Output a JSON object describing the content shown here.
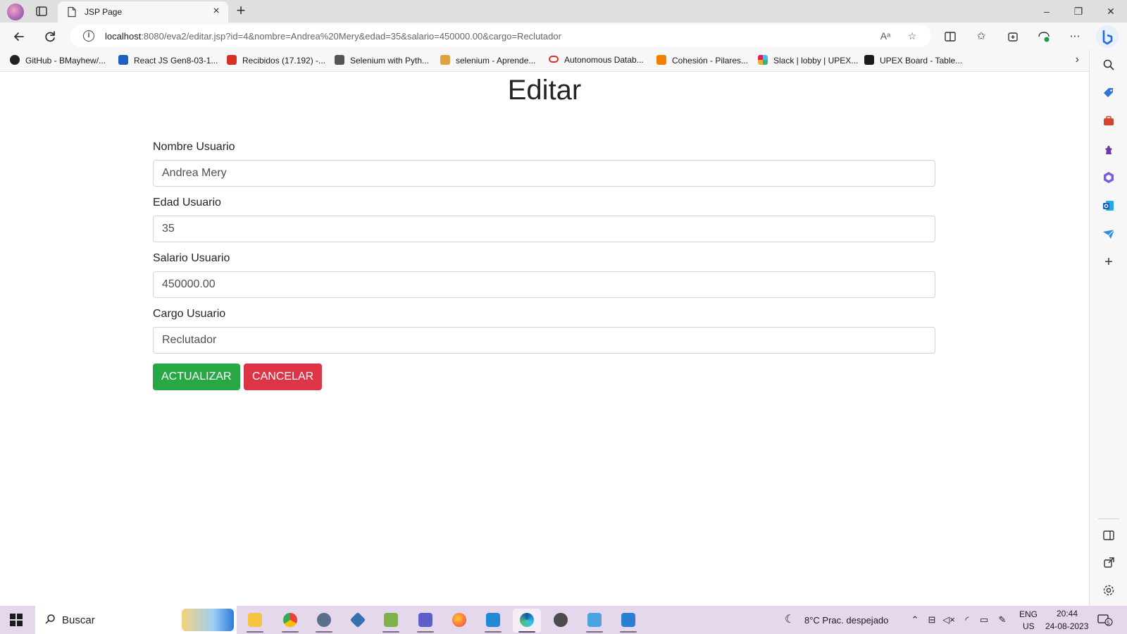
{
  "browser": {
    "tab_title": "JSP Page",
    "new_tab_symbol": "+",
    "close_symbol": "×",
    "window_controls": {
      "minimize": "–",
      "maximize": "❐",
      "close": "✕"
    },
    "url_host": "localhost",
    "url_rest": ":8080/eva2/editar.jsp?id=4&nombre=Andrea%20Mery&edad=35&salario=450000.00&cargo=Reclutador",
    "more_symbol": "⋯"
  },
  "bookmarks": [
    {
      "label": "GitHub - BMayhew/...",
      "icon": "github-icon",
      "color": "#222222"
    },
    {
      "label": "React JS Gen8-03-1...",
      "icon": "person-badge-icon",
      "color": "#1f5fbf"
    },
    {
      "label": "Recibidos (17.192) -...",
      "icon": "gmail-icon",
      "color": "#d93025"
    },
    {
      "label": "Selenium with Pyth...",
      "icon": "doc-icon",
      "color": "#555555"
    },
    {
      "label": "selenium - Aprende...",
      "icon": "selenium-icon",
      "color": "#e2a23b"
    },
    {
      "label": "Autonomous Datab...",
      "icon": "oracle-icon",
      "color": "#e0301e"
    },
    {
      "label": "Cohesión - Pilares...",
      "icon": "blogger-icon",
      "color": "#f57d00"
    },
    {
      "label": "Slack | lobby | UPEX...",
      "icon": "slack-icon",
      "color": "#e01e5a"
    },
    {
      "label": "UPEX Board - Table...",
      "icon": "upex-icon",
      "color": "#1b1b1b"
    }
  ],
  "page": {
    "title": "Editar",
    "fields": [
      {
        "label": "Nombre Usuario",
        "value": "Andrea Mery"
      },
      {
        "label": "Edad Usuario",
        "value": "35"
      },
      {
        "label": "Salario Usuario",
        "value": "450000.00"
      },
      {
        "label": "Cargo Usuario",
        "value": "Reclutador"
      }
    ],
    "submit_label": "ACTUALIZAR",
    "cancel_label": "CANCELAR",
    "colors": {
      "submit": "#28a745",
      "cancel": "#dc3545"
    }
  },
  "taskbar": {
    "search_placeholder": "Buscar",
    "weather": "8°C  Prac. despejado",
    "lang_top": "ENG",
    "lang_bottom": "US",
    "time": "20:44",
    "date": "24-08-2023",
    "notification_count": "5"
  }
}
